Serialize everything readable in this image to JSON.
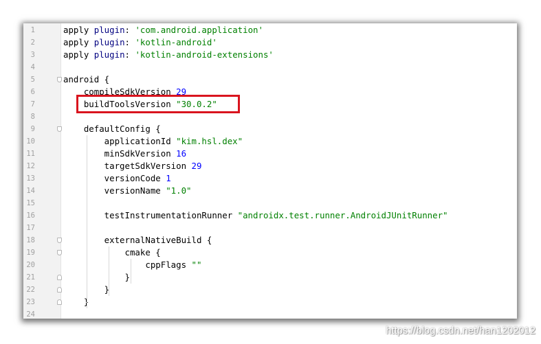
{
  "editor": {
    "lines": [
      {
        "n": "1",
        "parts": [
          {
            "t": "apply ",
            "c": "txt"
          },
          {
            "t": "plugin",
            "c": "kw"
          },
          {
            "t": ": ",
            "c": "txt"
          },
          {
            "t": "'com.android.application'",
            "c": "str"
          }
        ]
      },
      {
        "n": "2",
        "parts": [
          {
            "t": "apply ",
            "c": "txt"
          },
          {
            "t": "plugin",
            "c": "kw"
          },
          {
            "t": ": ",
            "c": "txt"
          },
          {
            "t": "'kotlin-android'",
            "c": "str"
          }
        ]
      },
      {
        "n": "3",
        "parts": [
          {
            "t": "apply ",
            "c": "txt"
          },
          {
            "t": "plugin",
            "c": "kw"
          },
          {
            "t": ": ",
            "c": "txt"
          },
          {
            "t": "'kotlin-android-extensions'",
            "c": "str"
          }
        ]
      },
      {
        "n": "4",
        "parts": []
      },
      {
        "n": "5",
        "fold": "start",
        "parts": [
          {
            "t": "android {",
            "c": "txt"
          }
        ]
      },
      {
        "n": "6",
        "parts": [
          {
            "t": "    compileSdkVersion ",
            "c": "txt"
          },
          {
            "t": "29",
            "c": "num"
          }
        ]
      },
      {
        "n": "7",
        "parts": [
          {
            "t": "    buildToolsVersion ",
            "c": "txt"
          },
          {
            "t": "\"30.0.2\"",
            "c": "str"
          }
        ]
      },
      {
        "n": "8",
        "parts": []
      },
      {
        "n": "9",
        "fold": "start",
        "parts": [
          {
            "t": "    defaultConfig {",
            "c": "txt"
          }
        ]
      },
      {
        "n": "10",
        "parts": [
          {
            "t": "        applicationId ",
            "c": "txt"
          },
          {
            "t": "\"kim.hsl.dex\"",
            "c": "str"
          }
        ]
      },
      {
        "n": "11",
        "parts": [
          {
            "t": "        minSdkVersion ",
            "c": "txt"
          },
          {
            "t": "16",
            "c": "num"
          }
        ]
      },
      {
        "n": "12",
        "parts": [
          {
            "t": "        targetSdkVersion ",
            "c": "txt"
          },
          {
            "t": "29",
            "c": "num"
          }
        ]
      },
      {
        "n": "13",
        "parts": [
          {
            "t": "        versionCode ",
            "c": "txt"
          },
          {
            "t": "1",
            "c": "num"
          }
        ]
      },
      {
        "n": "14",
        "parts": [
          {
            "t": "        versionName ",
            "c": "txt"
          },
          {
            "t": "\"1.0\"",
            "c": "str"
          }
        ]
      },
      {
        "n": "15",
        "parts": []
      },
      {
        "n": "16",
        "parts": [
          {
            "t": "        testInstrumentationRunner ",
            "c": "txt"
          },
          {
            "t": "\"androidx.test.runner.AndroidJUnitRunner\"",
            "c": "str"
          }
        ]
      },
      {
        "n": "17",
        "parts": []
      },
      {
        "n": "18",
        "fold": "start",
        "parts": [
          {
            "t": "        externalNativeBuild {",
            "c": "txt"
          }
        ]
      },
      {
        "n": "19",
        "fold": "start",
        "parts": [
          {
            "t": "            cmake {",
            "c": "txt"
          }
        ]
      },
      {
        "n": "20",
        "parts": [
          {
            "t": "                cppFlags ",
            "c": "txt"
          },
          {
            "t": "\"\"",
            "c": "str"
          }
        ]
      },
      {
        "n": "21",
        "fold": "end",
        "parts": [
          {
            "t": "            }",
            "c": "txt"
          }
        ]
      },
      {
        "n": "22",
        "fold": "end",
        "parts": [
          {
            "t": "        }",
            "c": "txt"
          }
        ]
      },
      {
        "n": "23",
        "fold": "end",
        "parts": [
          {
            "t": "    }",
            "c": "txt"
          }
        ]
      },
      {
        "n": "24",
        "parts": []
      }
    ]
  },
  "watermark": "https://blog.csdn.net/han1202012",
  "colors": {
    "keyword": "#000080",
    "string": "#008000",
    "number": "#0000ff",
    "highlight_border": "#d9141e",
    "gutter_bg": "#f2f2f2"
  }
}
